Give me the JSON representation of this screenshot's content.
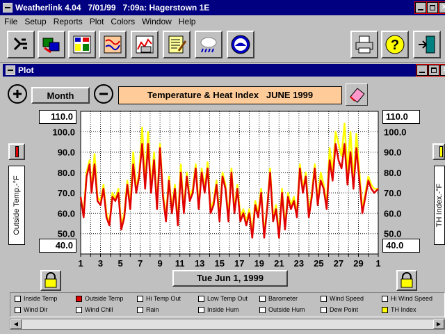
{
  "app": {
    "title": "Weatherlink 4.04   7/01/99   7:09a: Hagerstown 1E"
  },
  "menu": [
    "File",
    "Setup",
    "Reports",
    "Plot",
    "Colors",
    "Window",
    "Help"
  ],
  "toolbar": {
    "buttons": [
      "station-icon",
      "transfer-icon",
      "bulletin-icon",
      "summary-icon",
      "plot-icon",
      "notes-icon",
      "forecast-icon",
      "noaa-icon",
      "print-icon",
      "help-icon",
      "exit-icon"
    ]
  },
  "plot_window": {
    "title": "Plot",
    "month_button": "Month",
    "heading": "Temperature & Heat Index   JUNE 1999",
    "left_axis_label": "Outside Temp.-°F",
    "right_axis_label": "TH Index.-°F",
    "left_top_value": "110.0",
    "left_bottom_value": "40.0",
    "right_top_value": "110.0",
    "right_bottom_value": "40.0",
    "date_button": "Tue Jun 1, 1999",
    "colors": {
      "outside_temp": "#e00000",
      "th_index": "#ffff00",
      "heading_bg": "#ffcc99"
    }
  },
  "chart_data": {
    "type": "line",
    "title": "Temperature & Heat Index   JUNE 1999",
    "ylim": [
      40,
      110
    ],
    "yticks": [
      "110.0",
      "100.0",
      "90.0",
      "80.0",
      "70.0",
      "60.0",
      "50.0",
      "40.0"
    ],
    "xticks": [
      "1",
      "3",
      "5",
      "7",
      "9",
      "11",
      "13",
      "15",
      "17",
      "19",
      "21",
      "23",
      "25",
      "27",
      "29",
      "1"
    ],
    "xlim": [
      1,
      31
    ],
    "grid": true,
    "series": [
      {
        "name": "TH Index",
        "color": "#ffff00",
        "x": [
          1.0,
          1.3,
          1.6,
          1.9,
          2.1,
          2.4,
          2.7,
          3.0,
          3.3,
          3.6,
          3.9,
          4.2,
          4.5,
          4.8,
          5.1,
          5.4,
          5.7,
          6.0,
          6.3,
          6.6,
          6.9,
          7.2,
          7.5,
          7.8,
          8.1,
          8.4,
          8.7,
          9.0,
          9.3,
          9.6,
          9.9,
          10.2,
          10.5,
          10.8,
          11.1,
          11.4,
          11.7,
          12.0,
          12.3,
          12.6,
          12.9,
          13.2,
          13.5,
          13.8,
          14.1,
          14.4,
          14.7,
          15.0,
          15.3,
          15.6,
          15.9,
          16.2,
          16.5,
          16.8,
          17.1,
          17.4,
          17.7,
          18.0,
          18.3,
          18.6,
          18.9,
          19.2,
          19.5,
          19.8,
          20.1,
          20.4,
          20.7,
          21.0,
          21.3,
          21.6,
          21.9,
          22.2,
          22.5,
          22.8,
          23.1,
          23.4,
          23.7,
          24.0,
          24.3,
          24.6,
          24.9,
          25.2,
          25.5,
          25.8,
          26.1,
          26.4,
          26.7,
          27.0,
          27.3,
          27.6,
          27.9,
          28.2,
          28.5,
          28.8,
          29.1,
          29.4,
          29.7,
          30.0,
          30.3,
          30.6,
          31.0
        ],
        "values": [
          68,
          60,
          80,
          86,
          72,
          89,
          68,
          66,
          74,
          60,
          55,
          70,
          67,
          72,
          54,
          60,
          76,
          64,
          90,
          72,
          80,
          102,
          76,
          100,
          72,
          90,
          64,
          94,
          70,
          58,
          78,
          62,
          74,
          56,
          84,
          62,
          80,
          68,
          72,
          84,
          64,
          82,
          72,
          85,
          62,
          66,
          76,
          58,
          80,
          74,
          58,
          82,
          62,
          74,
          58,
          62,
          56,
          62,
          50,
          66,
          60,
          72,
          50,
          63,
          82,
          58,
          64,
          50,
          72,
          54,
          70,
          64,
          68,
          60,
          84,
          72,
          80,
          60,
          70,
          84,
          66,
          80,
          74,
          64,
          92,
          80,
          100,
          94,
          88,
          104,
          80,
          100,
          76,
          99,
          80,
          62,
          70,
          78,
          74,
          72,
          72
        ]
      },
      {
        "name": "Outside Temp",
        "color": "#e00000",
        "x": [
          1.0,
          1.3,
          1.6,
          1.9,
          2.1,
          2.4,
          2.7,
          3.0,
          3.3,
          3.6,
          3.9,
          4.2,
          4.5,
          4.8,
          5.1,
          5.4,
          5.7,
          6.0,
          6.3,
          6.6,
          6.9,
          7.2,
          7.5,
          7.8,
          8.1,
          8.4,
          8.7,
          9.0,
          9.3,
          9.6,
          9.9,
          10.2,
          10.5,
          10.8,
          11.1,
          11.4,
          11.7,
          12.0,
          12.3,
          12.6,
          12.9,
          13.2,
          13.5,
          13.8,
          14.1,
          14.4,
          14.7,
          15.0,
          15.3,
          15.6,
          15.9,
          16.2,
          16.5,
          16.8,
          17.1,
          17.4,
          17.7,
          18.0,
          18.3,
          18.6,
          18.9,
          19.2,
          19.5,
          19.8,
          20.1,
          20.4,
          20.7,
          21.0,
          21.3,
          21.6,
          21.9,
          22.2,
          22.5,
          22.8,
          23.1,
          23.4,
          23.7,
          24.0,
          24.3,
          24.6,
          24.9,
          25.2,
          25.5,
          25.8,
          26.1,
          26.4,
          26.7,
          27.0,
          27.3,
          27.6,
          27.9,
          28.2,
          28.5,
          28.8,
          29.1,
          29.4,
          29.7,
          30.0,
          30.3,
          30.6,
          31.0
        ],
        "values": [
          68,
          58,
          78,
          84,
          70,
          84,
          66,
          64,
          72,
          58,
          54,
          68,
          66,
          70,
          52,
          58,
          74,
          62,
          84,
          70,
          78,
          94,
          72,
          94,
          70,
          86,
          62,
          92,
          68,
          56,
          76,
          60,
          72,
          54,
          80,
          60,
          78,
          66,
          70,
          82,
          62,
          80,
          70,
          82,
          60,
          64,
          74,
          56,
          78,
          72,
          56,
          80,
          60,
          72,
          56,
          60,
          54,
          60,
          48,
          64,
          58,
          70,
          48,
          62,
          80,
          56,
          62,
          48,
          70,
          52,
          68,
          62,
          66,
          58,
          82,
          70,
          78,
          58,
          68,
          82,
          64,
          76,
          72,
          62,
          86,
          76,
          94,
          86,
          82,
          94,
          74,
          90,
          72,
          92,
          76,
          60,
          68,
          76,
          72,
          70,
          72
        ]
      }
    ]
  },
  "legend": [
    {
      "label": "Inside Temp",
      "checked": false,
      "color": "#ffffff"
    },
    {
      "label": "Outside Temp",
      "checked": true,
      "color": "#e00000"
    },
    {
      "label": "Hi Temp Out",
      "checked": false,
      "color": "#ffffff"
    },
    {
      "label": "Low Temp Out",
      "checked": false,
      "color": "#ffffff"
    },
    {
      "label": "Barometer",
      "checked": false,
      "color": "#ffffff"
    },
    {
      "label": "Wind Speed",
      "checked": false,
      "color": "#ffffff"
    },
    {
      "label": "Hi Wind Speed",
      "checked": false,
      "color": "#ffffff"
    },
    {
      "label": "Wind Dir",
      "checked": false,
      "color": "#ffffff"
    },
    {
      "label": "Wind Chill",
      "checked": false,
      "color": "#ffffff"
    },
    {
      "label": "Rain",
      "checked": false,
      "color": "#ffffff"
    },
    {
      "label": "Inside Hum",
      "checked": false,
      "color": "#ffffff"
    },
    {
      "label": "Outside Hum",
      "checked": false,
      "color": "#ffffff"
    },
    {
      "label": "Dew Point",
      "checked": false,
      "color": "#ffffff"
    },
    {
      "label": "TH Index",
      "checked": true,
      "color": "#ffff00"
    }
  ]
}
